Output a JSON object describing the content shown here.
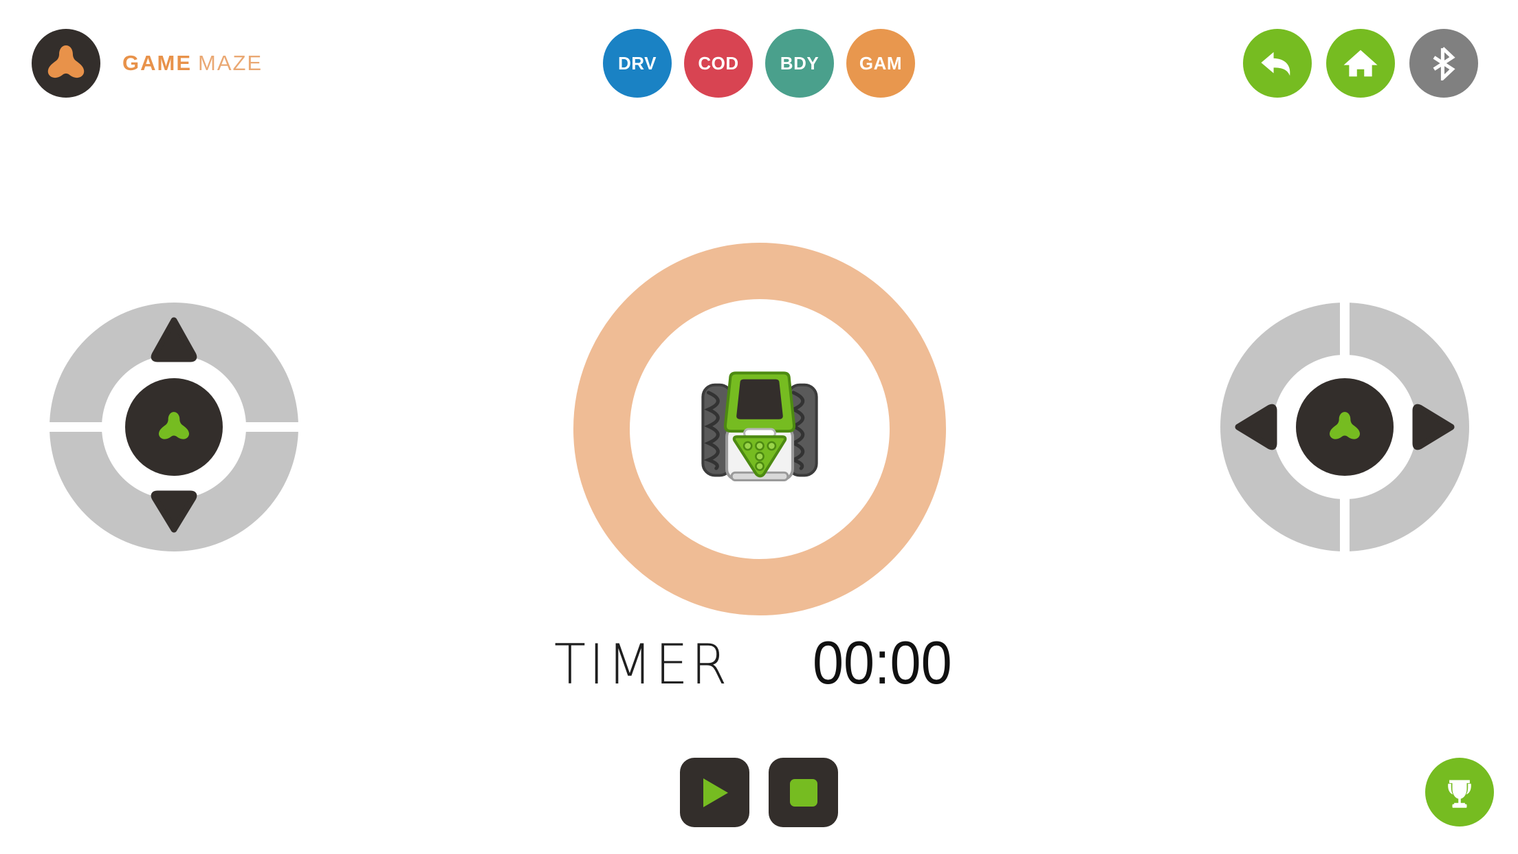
{
  "header": {
    "brand": {
      "logo_icon": "clover-logo-icon",
      "game_word": "GAME",
      "maze_word": "MAZE",
      "logo_bg": "#332e2b",
      "logo_mark_color": "#e8924a",
      "game_color": "#e8924a",
      "maze_color": "#eaa873"
    },
    "nav_pills": [
      {
        "label": "DRV",
        "color": "#1a82c4",
        "name": "nav-pill-drv"
      },
      {
        "label": "COD",
        "color": "#d84452",
        "name": "nav-pill-cod"
      },
      {
        "label": "BDY",
        "color": "#4aa08c",
        "name": "nav-pill-bdy"
      },
      {
        "label": "GAM",
        "color": "#e8974e",
        "name": "nav-pill-gam"
      }
    ],
    "actions": [
      {
        "icon": "back-arrow-icon",
        "color": "#76bc21",
        "name": "back-button"
      },
      {
        "icon": "home-icon",
        "color": "#76bc21",
        "name": "home-button"
      },
      {
        "icon": "bluetooth-icon",
        "color": "#808080",
        "name": "bluetooth-button"
      }
    ]
  },
  "controls": {
    "left_dpad": {
      "name": "dpad-vertical",
      "split": "horizontal",
      "up_icon": "triangle-up-icon",
      "down_icon": "triangle-down-icon",
      "hub_icon": "clover-logo-icon",
      "ring_color": "#c4c4c4",
      "hub_color": "#332e2b",
      "hub_mark_color": "#76bc21",
      "arrow_color": "#332e2b"
    },
    "right_dpad": {
      "name": "dpad-horizontal",
      "split": "vertical",
      "left_icon": "triangle-left-icon",
      "right_icon": "triangle-right-icon",
      "hub_icon": "clover-logo-icon",
      "ring_color": "#c4c4c4",
      "hub_color": "#332e2b",
      "hub_mark_color": "#76bc21",
      "arrow_color": "#332e2b"
    }
  },
  "dial": {
    "name": "heading-dial",
    "ring_color": "#efbc95",
    "tick_color": "#ffffff",
    "major_ticks": 4,
    "minor_ticks": 8,
    "robot_icon": "robot-top-view-icon",
    "robot_body_color": "#f2f2f2",
    "robot_accent_color": "#76bc21",
    "robot_tire_color": "#4a4a4a",
    "robot_screen_color": "#332e2b"
  },
  "timer": {
    "label": "TIMER",
    "value": "00:00"
  },
  "transport": {
    "play": {
      "label": "play-button",
      "icon": "play-icon",
      "icon_color": "#76bc21",
      "bg": "#332e2b"
    },
    "stop": {
      "label": "stop-button",
      "icon": "stop-icon",
      "icon_color": "#76bc21",
      "bg": "#332e2b"
    }
  },
  "trophy": {
    "name": "achievements-button",
    "icon": "trophy-icon",
    "color": "#76bc21"
  }
}
